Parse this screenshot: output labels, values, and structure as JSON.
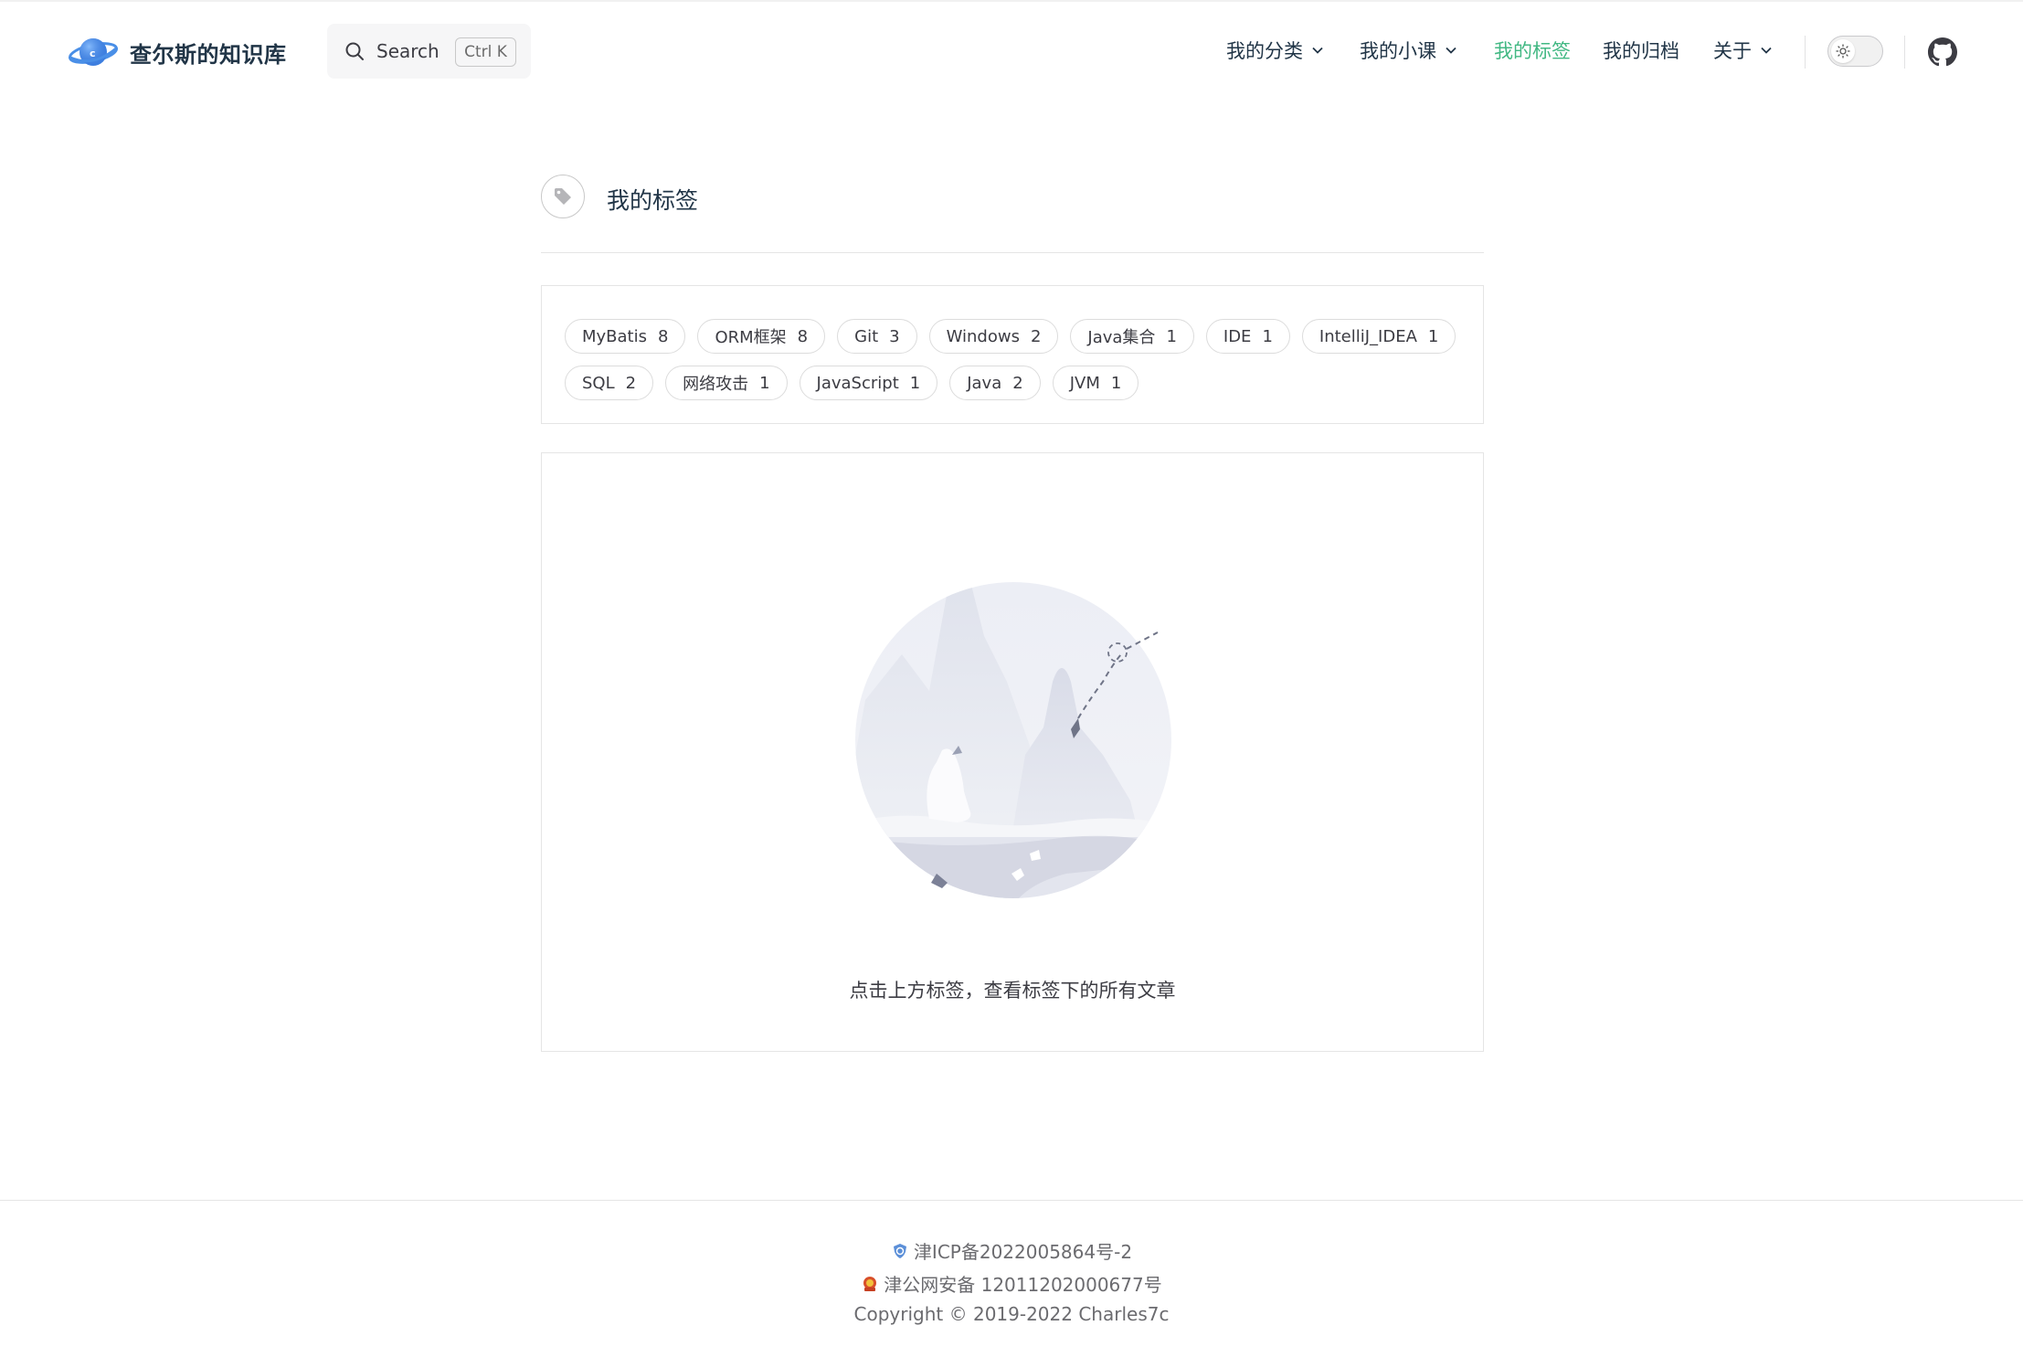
{
  "site": {
    "title": "查尔斯的知识库"
  },
  "search": {
    "label": "Search",
    "shortcut": "Ctrl K"
  },
  "nav": {
    "items": [
      {
        "label": "我的分类",
        "dropdown": true,
        "active": false
      },
      {
        "label": "我的小课",
        "dropdown": true,
        "active": false
      },
      {
        "label": "我的标签",
        "dropdown": false,
        "active": true
      },
      {
        "label": "我的归档",
        "dropdown": false,
        "active": false
      },
      {
        "label": "关于",
        "dropdown": true,
        "active": false
      }
    ],
    "active_color": "#42b883"
  },
  "page": {
    "title": "我的标签"
  },
  "tags": {
    "row1": [
      {
        "name": "MyBatis",
        "count": "8"
      },
      {
        "name": "ORM框架",
        "count": "8"
      },
      {
        "name": "Git",
        "count": "3"
      },
      {
        "name": "Windows",
        "count": "2"
      },
      {
        "name": "Java集合",
        "count": "1"
      },
      {
        "name": "IDE",
        "count": "1"
      },
      {
        "name": "IntelliJ_IDEA",
        "count": "1"
      }
    ],
    "row2": [
      {
        "name": "SQL",
        "count": "2"
      },
      {
        "name": "网络攻击",
        "count": "1"
      },
      {
        "name": "JavaScript",
        "count": "1"
      },
      {
        "name": "Java",
        "count": "2"
      },
      {
        "name": "JVM",
        "count": "1"
      }
    ]
  },
  "empty": {
    "text": "点击上方标签，查看标签下的所有文章"
  },
  "footer": {
    "icp": "津ICP备2022005864号-2",
    "police": "津公网安备 12011202000677号",
    "copyright": "Copyright © 2019-2022 Charles7c"
  }
}
